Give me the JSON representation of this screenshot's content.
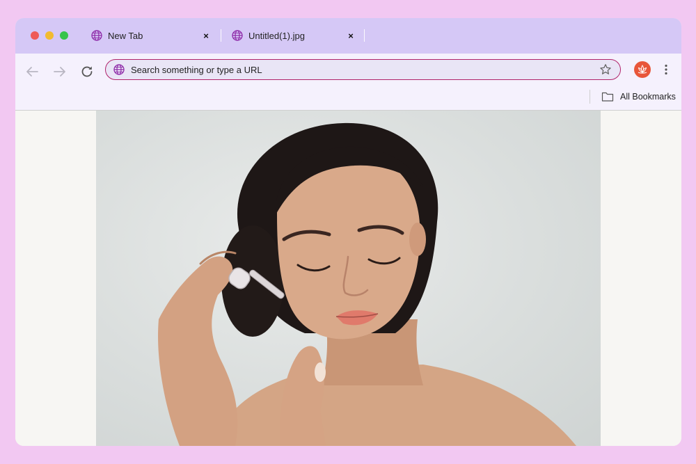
{
  "window": {
    "traffic_lights": [
      "close",
      "minimize",
      "zoom"
    ]
  },
  "tabs": [
    {
      "title": "New Tab",
      "icon": "globe-icon",
      "close": "×"
    },
    {
      "title": "Untitled(1).jpg",
      "icon": "globe-icon",
      "close": "×"
    }
  ],
  "toolbar": {
    "back_icon": "arrow-left-icon",
    "forward_icon": "arrow-right-icon",
    "reload_icon": "reload-icon",
    "address": {
      "value": "",
      "placeholder": "Search something or type a URL",
      "icon": "globe-icon"
    },
    "bookmark_star_icon": "star-icon",
    "profile_icon": "lotus-icon",
    "menu_icon": "kebab-menu-icon"
  },
  "bookmarks_bar": {
    "label": "All Bookmarks",
    "icon": "folder-icon"
  },
  "content": {
    "image": "photo-of-woman-applying-face-serum-with-dropper"
  },
  "colors": {
    "page_background": "#f2c8f2",
    "tabbar": "#d5c8f6",
    "toolbar": "#f5f1fd",
    "address_border": "#b0226a",
    "address_fill": "#e9e5f6",
    "globe": "#8e2aa8",
    "profile": "#e8563a",
    "traffic_red": "#ee5a57",
    "traffic_yellow": "#f2bb2f",
    "traffic_green": "#36c44a"
  }
}
